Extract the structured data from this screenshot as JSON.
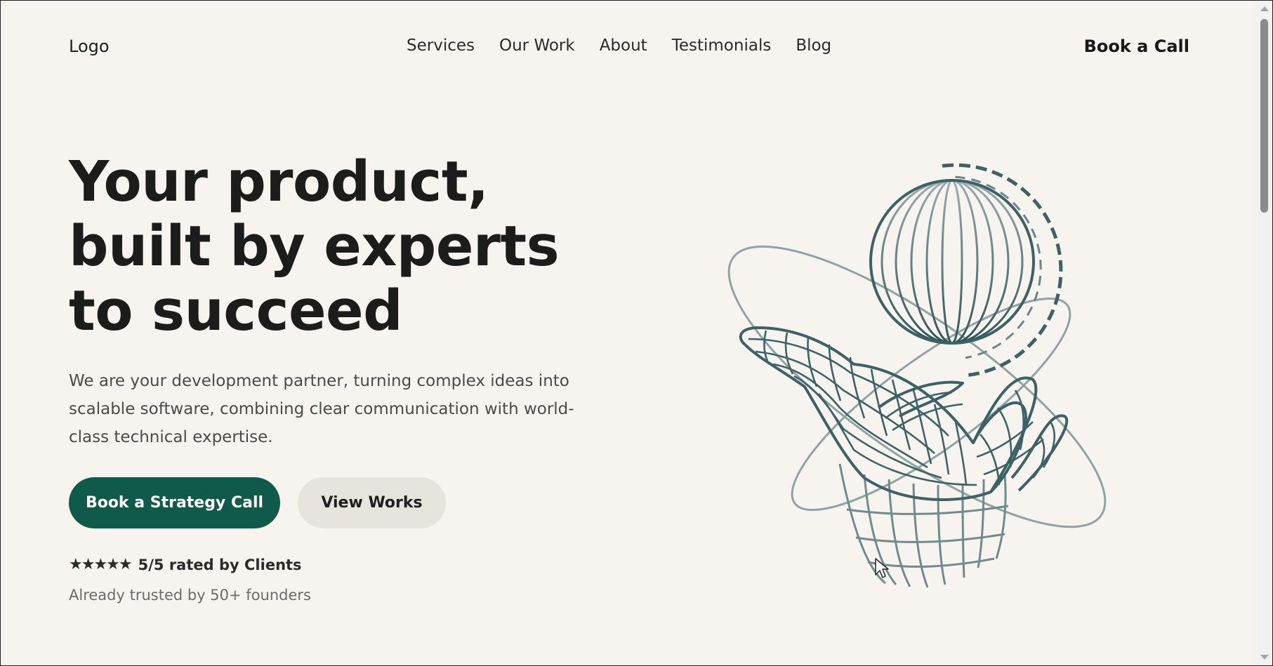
{
  "header": {
    "logo": "Logo",
    "nav": [
      "Services",
      "Our Work",
      "About",
      "Testimonials",
      "Blog"
    ],
    "cta": "Book a Call"
  },
  "hero": {
    "title": "Your product, built by experts to succeed",
    "description": "We are your development partner, turning complex ideas into scalable software, combining clear communication with world-class technical expertise.",
    "primary_button": "Book a Strategy Call",
    "secondary_button": "View Works",
    "rating_stars": "★★★★★",
    "rating_text": "5/5 rated by Clients",
    "trusted_text": "Already trusted by 50+ founders"
  },
  "colors": {
    "background": "#f7f4ef",
    "primary": "#0f5a48",
    "secondary_button": "#e7e3dd",
    "illustration": "#3d5f63"
  },
  "icons": {
    "illustration": "wireframe-hand-holding-globe",
    "cursor": "mouse-pointer-icon"
  }
}
